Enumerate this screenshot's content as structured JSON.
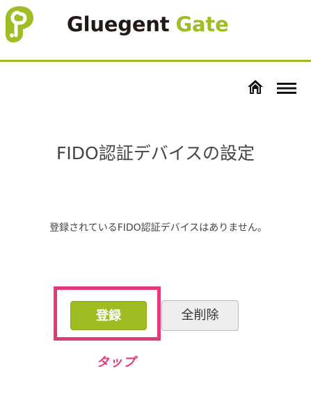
{
  "header": {
    "brand_name_part1": "Gluegent",
    "brand_name_part2": "Gate"
  },
  "nav": {
    "home_icon": "home-icon",
    "menu_icon": "hamburger-menu-icon"
  },
  "main": {
    "title": "FIDO認証デバイスの設定",
    "message": "登録されているFIDO認証デバイスはありません。",
    "register_button_label": "登録",
    "delete_all_button_label": "全削除"
  },
  "annotation": {
    "tap_label": "タップ"
  },
  "colors": {
    "brand_green": "#9dbd22",
    "highlight_pink": "#e3387c",
    "logo_dark": "#231815"
  }
}
